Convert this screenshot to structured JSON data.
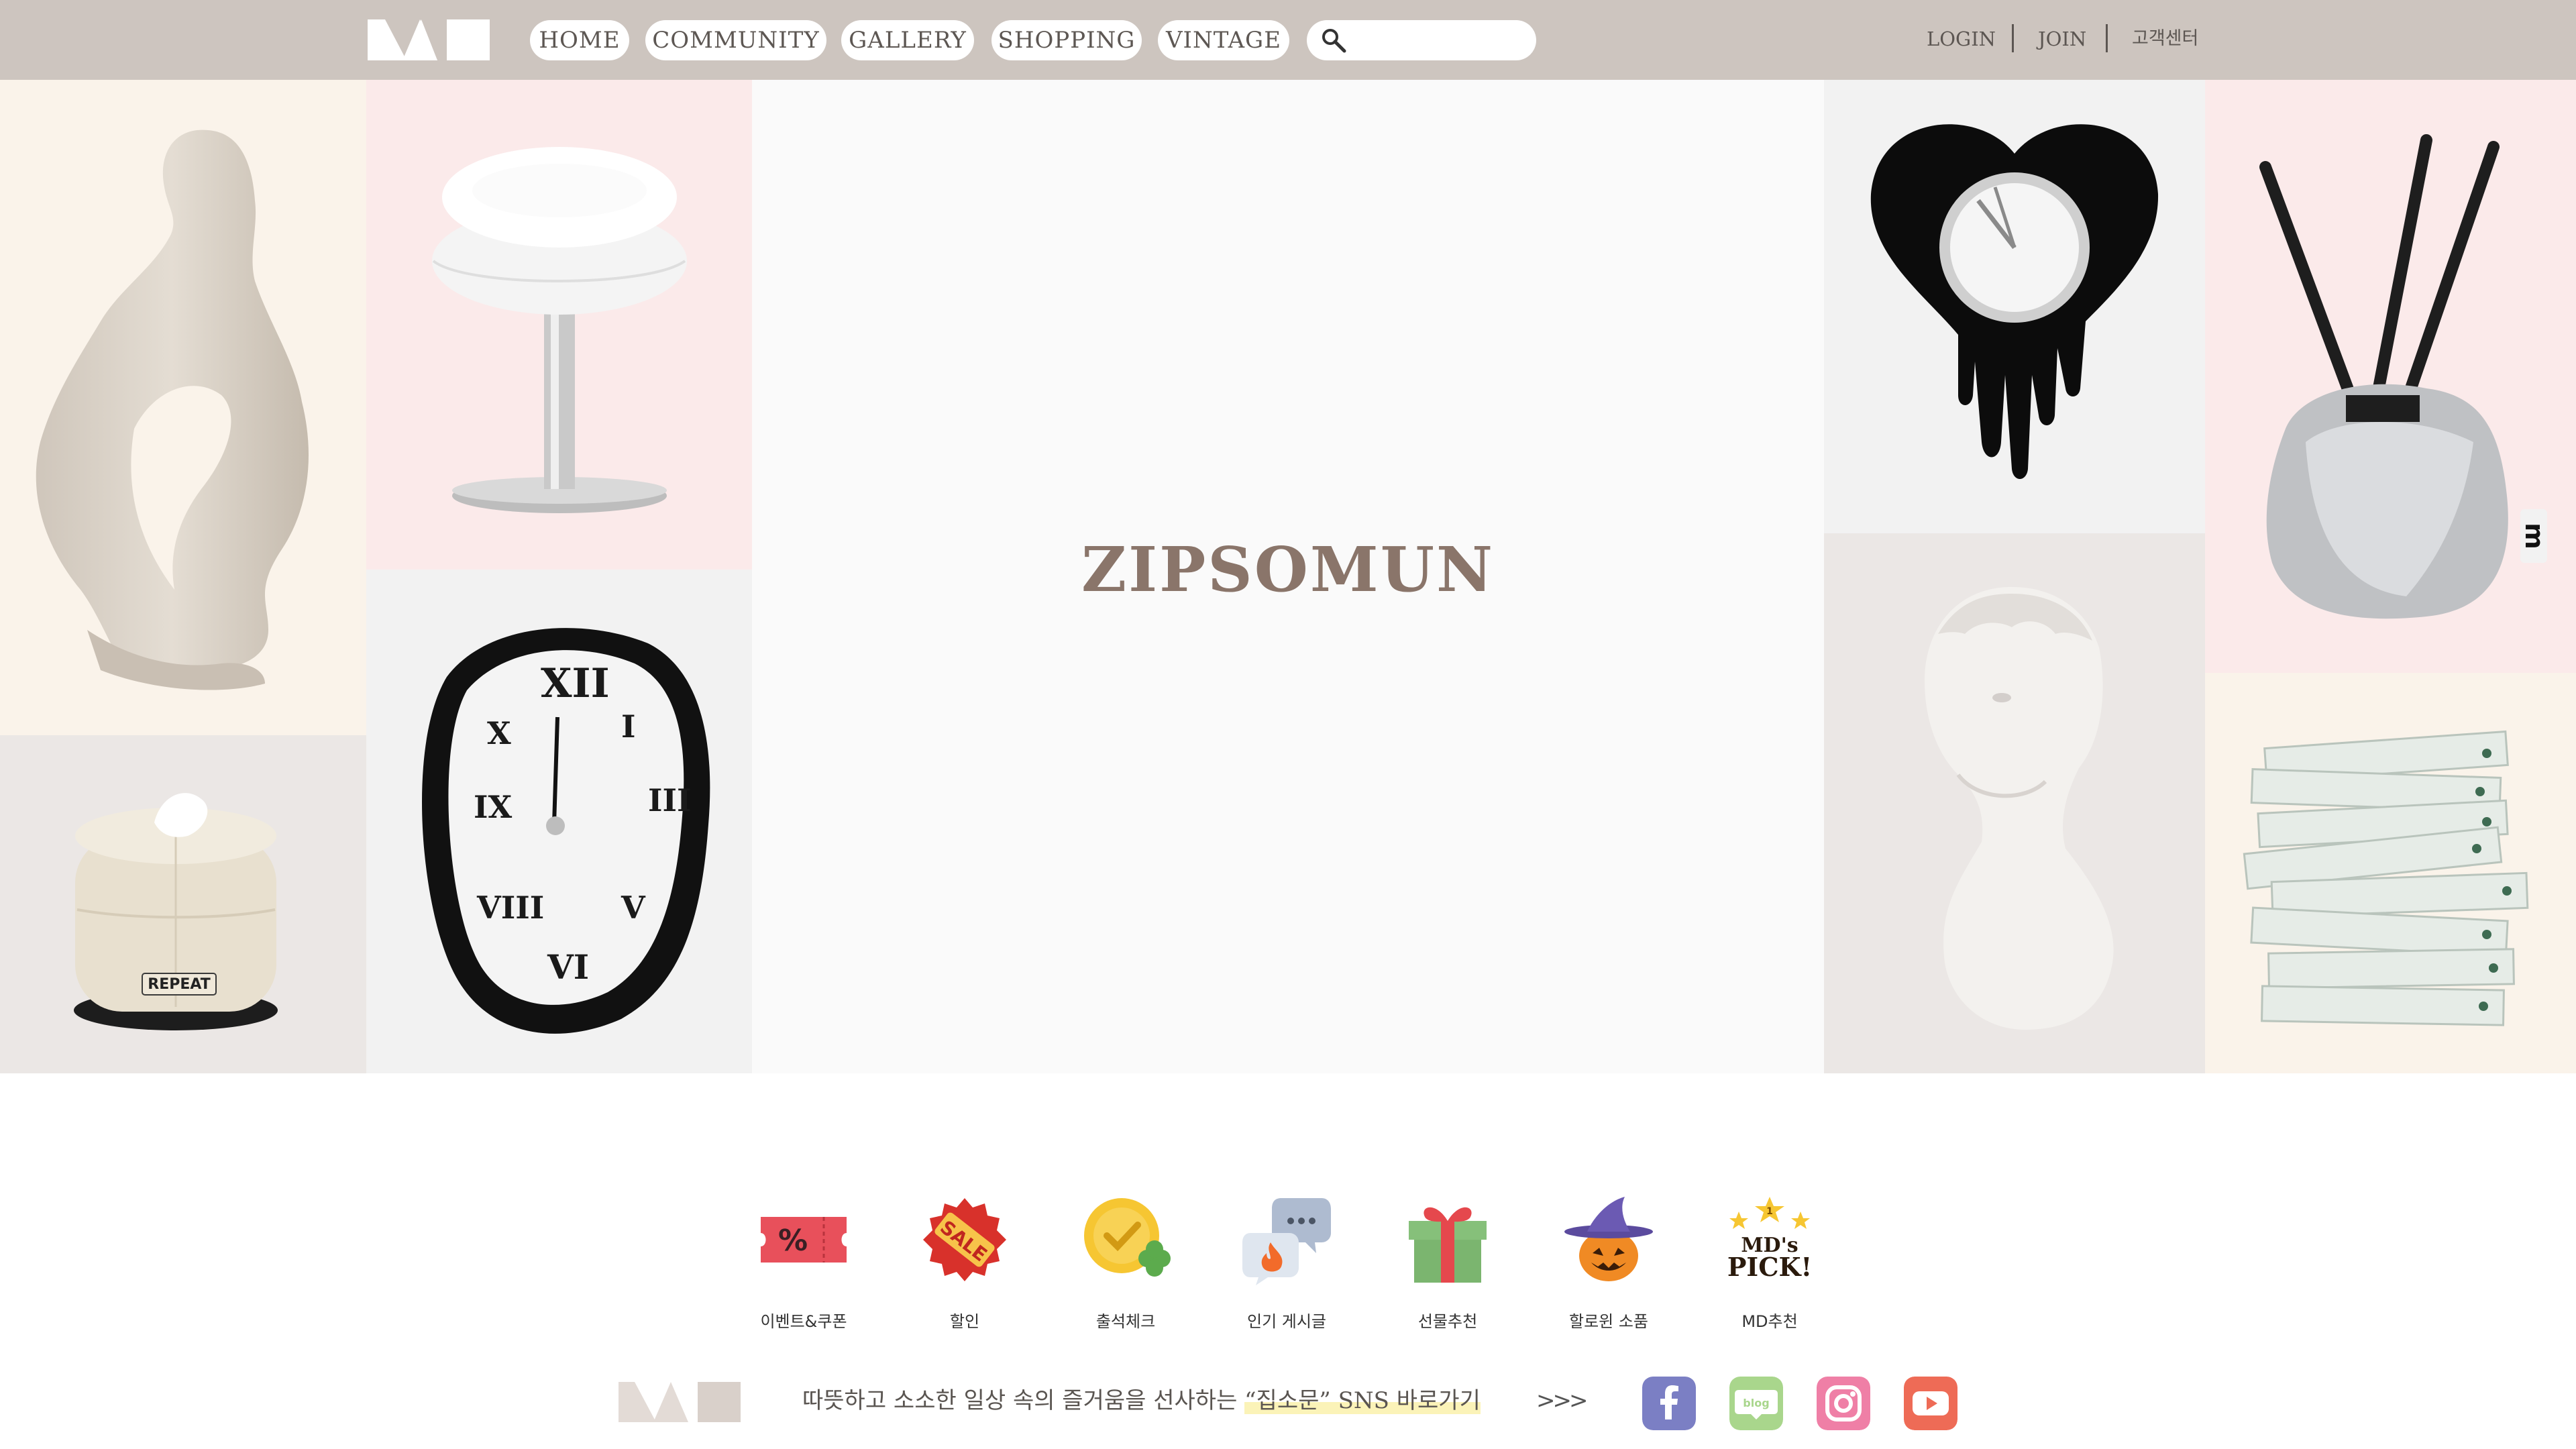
{
  "header": {
    "nav": [
      {
        "id": "home",
        "label": "HOME"
      },
      {
        "id": "community",
        "label": "COMMUNITY"
      },
      {
        "id": "gallery",
        "label": "GALLERY"
      },
      {
        "id": "shopping",
        "label": "SHOPPING"
      },
      {
        "id": "vintage",
        "label": "VINTAGE"
      }
    ],
    "search": {
      "placeholder": "",
      "value": ""
    },
    "util": {
      "login": "LOGIN",
      "join": "JOIN",
      "support": "고객센터"
    }
  },
  "hero": {
    "brand": "ZIPSOMUN",
    "tissue_label": "REPEAT",
    "candle_label": "m",
    "colors": {
      "cream": "#faf3ea",
      "pink": "#fbeaea",
      "gray": "#f2f2f2",
      "warmgray": "#ebe7e5"
    }
  },
  "quick_menu": [
    {
      "label": "이벤트&쿠폰",
      "icon": "coupon-icon"
    },
    {
      "label": "할인",
      "icon": "sale-tag-icon",
      "icon_text": "SALE"
    },
    {
      "label": "출석체크",
      "icon": "attendance-check-icon"
    },
    {
      "label": "인기 게시글",
      "icon": "popular-post-icon"
    },
    {
      "label": "선물추천",
      "icon": "gift-icon"
    },
    {
      "label": "할로윈 소품",
      "icon": "halloween-icon"
    },
    {
      "label": "MD추천",
      "icon": "md-pick-icon",
      "icon_text_1": "1",
      "icon_text_2": "MD's",
      "icon_text_3": "PICK!"
    }
  ],
  "footer": {
    "text_before": "따뜻하고 소소한 일상 속의 즐거움을 선사하는 ",
    "text_highlight": "“집소문” SNS 바로가기",
    "arrows": ">>>",
    "sns": [
      {
        "name": "facebook",
        "icon": "facebook-icon",
        "color": "#7b7fc4"
      },
      {
        "name": "blog",
        "icon": "blog-icon",
        "color": "#a9d68c",
        "text": "blog"
      },
      {
        "name": "instagram",
        "icon": "instagram-icon",
        "color": "#ef7fa6"
      },
      {
        "name": "youtube",
        "icon": "youtube-icon",
        "color": "#ee6b56"
      }
    ]
  }
}
